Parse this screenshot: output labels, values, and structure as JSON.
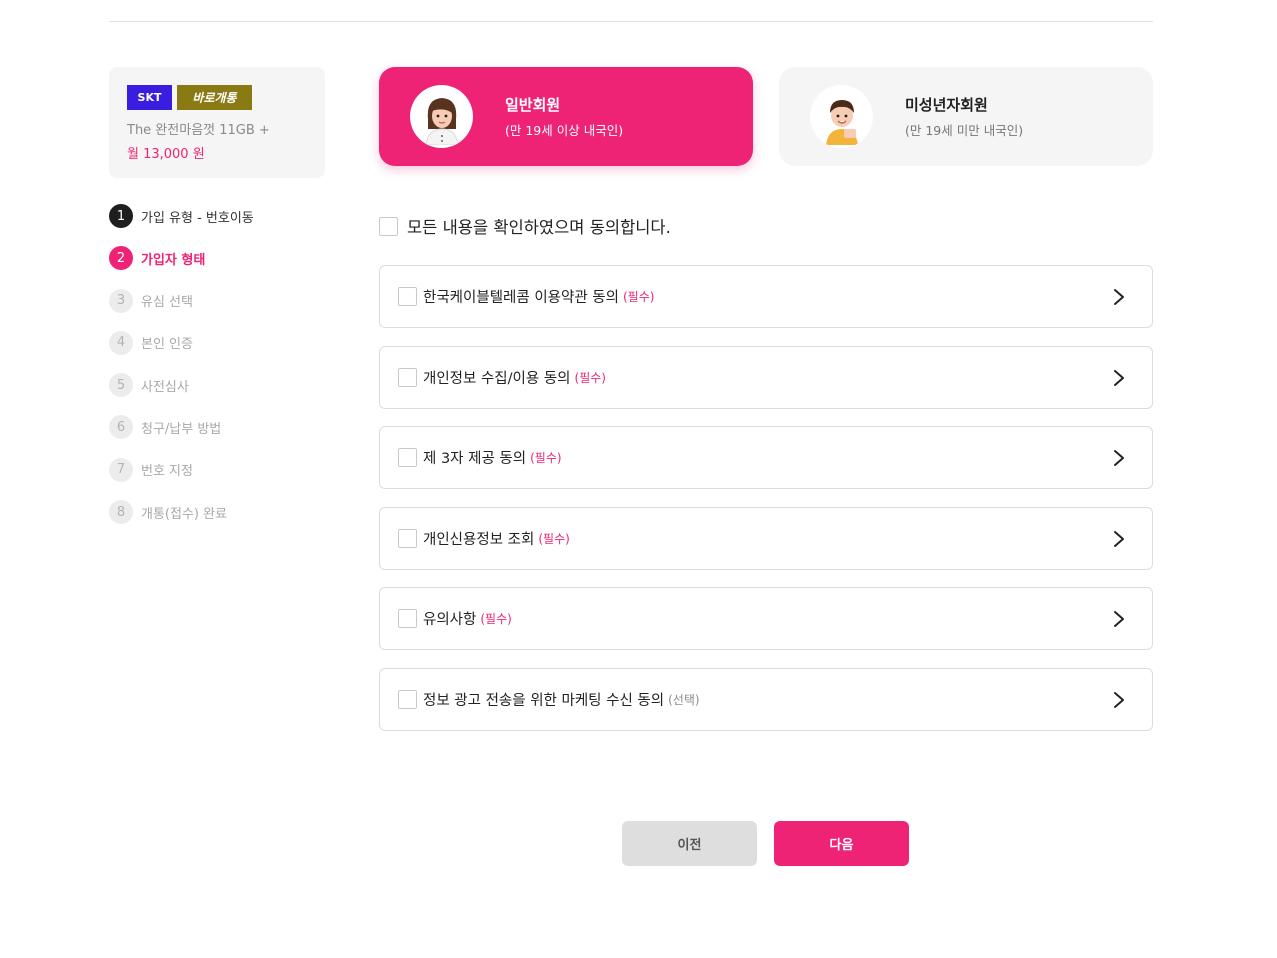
{
  "product": {
    "carrier_badge": "SKT",
    "open_badge": "바로개통",
    "plan_name": "The 완전마음껏 11GB +",
    "price": "월 13,000 원"
  },
  "steps": [
    {
      "num": "1",
      "label": "가입 유형 - 번호이동",
      "state": "done"
    },
    {
      "num": "2",
      "label": "가입자 형태",
      "state": "active"
    },
    {
      "num": "3",
      "label": "유심 선택",
      "state": "pending"
    },
    {
      "num": "4",
      "label": "본인 인증",
      "state": "pending"
    },
    {
      "num": "5",
      "label": "사전심사",
      "state": "pending"
    },
    {
      "num": "6",
      "label": "청구/납부 방법",
      "state": "pending"
    },
    {
      "num": "7",
      "label": "번호 지정",
      "state": "pending"
    },
    {
      "num": "8",
      "label": "개통(접수) 완료",
      "state": "pending"
    }
  ],
  "member_types": [
    {
      "title": "일반회원",
      "sub": "(만 19세 이상 내국인)",
      "selected": true,
      "icon": "adult-woman-avatar-icon"
    },
    {
      "title": "미성년자회원",
      "sub": "(만 19세 미만 내국인)",
      "selected": false,
      "icon": "child-boy-avatar-icon"
    }
  ],
  "agree_all": "모든 내용을 확인하였으며 동의합니다.",
  "terms": [
    {
      "label": "한국케이블텔레콤 이용약관 동의",
      "tag": "(필수)",
      "required": true
    },
    {
      "label": "개인정보 수집/이용 동의",
      "tag": "(필수)",
      "required": true
    },
    {
      "label": "제 3자 제공 동의",
      "tag": "(필수)",
      "required": true
    },
    {
      "label": "개인신용정보 조회",
      "tag": "(필수)",
      "required": true
    },
    {
      "label": "유의사항",
      "tag": "(필수)",
      "required": true
    },
    {
      "label": "정보 광고 전송을 위한 마케팅 수신 동의",
      "tag": "(선택)",
      "required": false
    }
  ],
  "buttons": {
    "prev": "이전",
    "next": "다음"
  },
  "colors": {
    "accent": "#ee2376",
    "carrier_badge": "#3a1ee0",
    "open_badge": "#8a7a14"
  }
}
